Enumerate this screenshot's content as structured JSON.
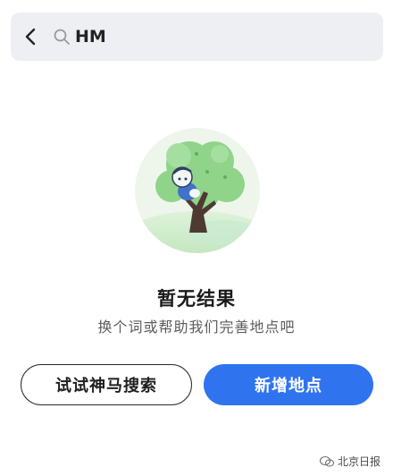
{
  "search": {
    "query": "HM"
  },
  "icons": {
    "back": "chevron-left-icon",
    "search": "search-icon",
    "illustration": "tree-with-character-illustration",
    "watermark": "wechat-icon"
  },
  "empty_state": {
    "title": "暂无结果",
    "subtitle": "换个词或帮助我们完善地点吧"
  },
  "actions": {
    "try_search_label": "试试神马搜索",
    "add_place_label": "新增地点"
  },
  "watermark": {
    "text": "北京日报"
  },
  "colors": {
    "primary": "#2f74ee",
    "search_bg": "#eeeff2",
    "tree_green": "#7fcf7a",
    "circle_bg": "#eef6ec"
  }
}
